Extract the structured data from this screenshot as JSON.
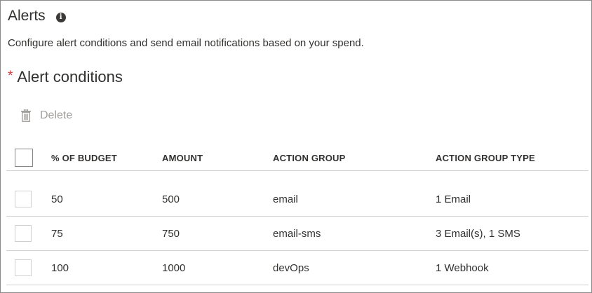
{
  "panel": {
    "title": "Alerts",
    "info_icon": "info-icon",
    "description": "Configure alert conditions and send email notifications based on your spend."
  },
  "section": {
    "required_marker": "*",
    "title": "Alert conditions"
  },
  "toolbar": {
    "delete_label": "Delete",
    "delete_icon": "trash-icon"
  },
  "table": {
    "columns": [
      "% OF BUDGET",
      "AMOUNT",
      "ACTION GROUP",
      "ACTION GROUP TYPE"
    ],
    "rows": [
      {
        "percent": "50",
        "amount": "500",
        "action_group": "email",
        "action_group_type": "1 Email"
      },
      {
        "percent": "75",
        "amount": "750",
        "action_group": "email-sms",
        "action_group_type": "3 Email(s), 1 SMS"
      },
      {
        "percent": "100",
        "amount": "1000",
        "action_group": "devOps",
        "action_group_type": "1 Webhook"
      }
    ]
  },
  "colors": {
    "required": "#d13438",
    "disabled_text": "#a19f9d",
    "border": "#8a8a8a"
  }
}
